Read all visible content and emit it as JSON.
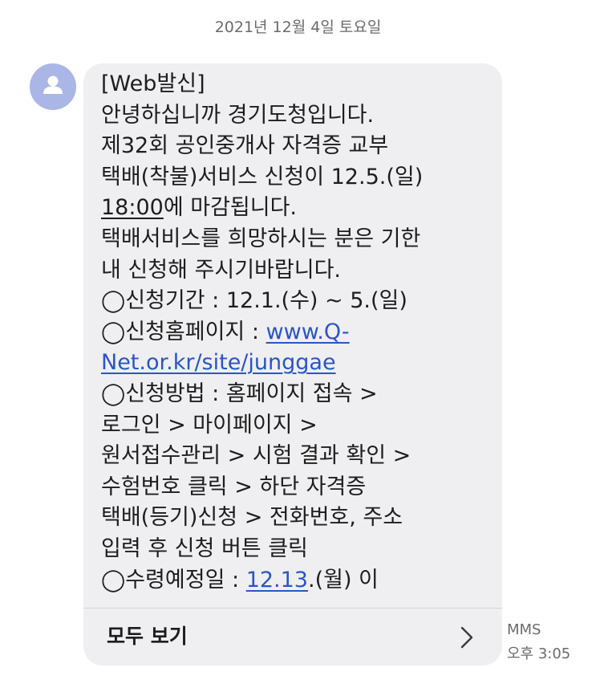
{
  "date_header": "2021년 12월 4일 토요일",
  "avatar": {
    "icon": "person-icon",
    "color": "#aab6e6"
  },
  "message": {
    "lines": [
      {
        "text": "[Web발신]"
      },
      {
        "text": "안녕하십니까 경기도청입니다."
      },
      {
        "text": "제32회 공인중개사 자격증 교부"
      },
      {
        "text": "택배(착불)서비스 신청이 12.5.(일)"
      },
      {
        "underlined": "18:00",
        "rest": "에 마감됩니다."
      },
      {
        "text": "택배서비스를 희망하시는 분은 기한"
      },
      {
        "text": "내 신청해 주시기바랍니다."
      },
      {
        "text": "◯신청기간 : 12.1.(수) ~ 5.(일)"
      },
      {
        "prefix": "◯신청홈페이지 : ",
        "link": "www.Q-"
      },
      {
        "link": "Net.or.kr/site/junggae"
      },
      {
        "text": "◯신청방법 : 홈페이지 접속 >"
      },
      {
        "text": "로그인 > 마이페이지 >"
      },
      {
        "text": "원서접수관리 > 시험 결과 확인 >"
      },
      {
        "text": "수험번호 클릭 > 하단 자격증"
      },
      {
        "text": "택배(등기)신청 > 전화번호, 주소"
      },
      {
        "text": "입력 후 신청 버튼 클릭"
      },
      {
        "prefix": "◯수령예정일 : ",
        "link": "12.13",
        "rest": ".(월) 이"
      }
    ]
  },
  "view_all": {
    "label": "모두 보기",
    "icon": "chevron-right-icon"
  },
  "meta": {
    "type": "MMS",
    "time": "오후 3:05"
  },
  "colors": {
    "bubble": "#efeff1",
    "link": "#2a55c7",
    "text": "#1d1d1d",
    "secondary_text": "#6b6b6b"
  }
}
